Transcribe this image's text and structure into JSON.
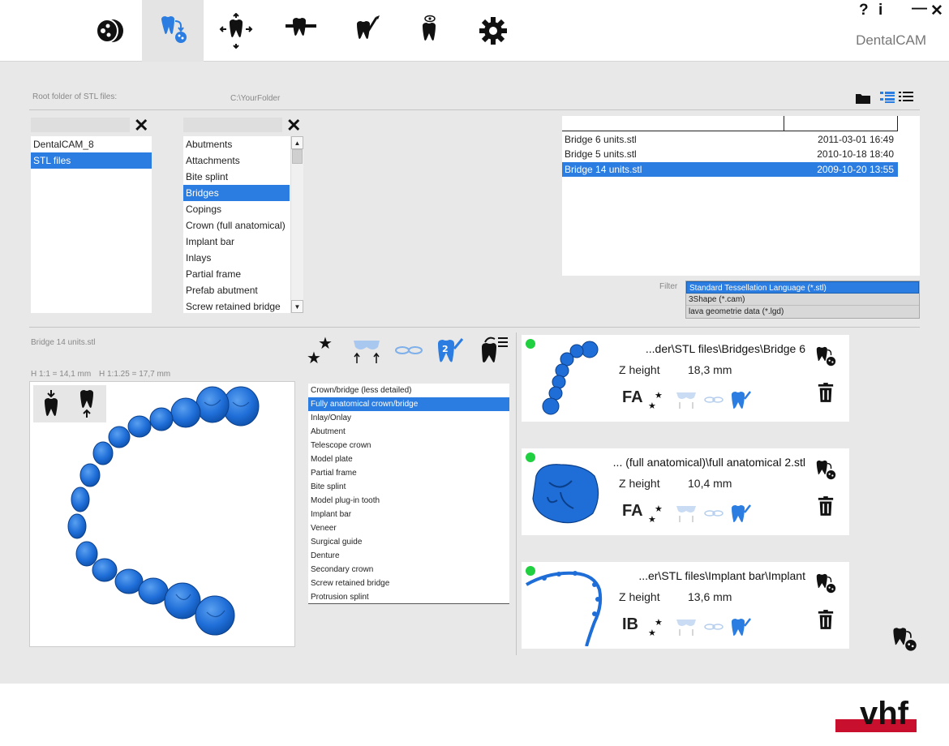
{
  "app": {
    "title": "DentalCAM",
    "help": "?",
    "info": "i",
    "minimize": "—",
    "close": "✕"
  },
  "tabs": [
    {
      "icon": "material-disc-icon",
      "active": false
    },
    {
      "icon": "tooth-import-icon",
      "active": true
    },
    {
      "icon": "tooth-position-icon",
      "active": false
    },
    {
      "icon": "tooth-holder-icon",
      "active": false
    },
    {
      "icon": "tooth-calculate-icon",
      "active": false
    },
    {
      "icon": "tooth-view-icon",
      "active": false
    },
    {
      "icon": "gear-icon",
      "active": false
    }
  ],
  "root": {
    "label": "Root folder of STL files:",
    "path": "C:\\YourFolder"
  },
  "folders": {
    "items": [
      "DentalCAM_8",
      "STL files"
    ],
    "selected": 1
  },
  "categories": {
    "items": [
      "Abutments",
      "Attachments",
      "Bite splint",
      "Bridges",
      "Copings",
      "Crown (full anatomical)",
      "Implant bar",
      "Inlays",
      "Partial frame",
      "Prefab abutment",
      "Screw retained bridge"
    ],
    "selected": 3
  },
  "files": [
    {
      "name": "Bridge 6 units.stl",
      "date": "2011-03-01  16:49"
    },
    {
      "name": "Bridge 5 units.stl",
      "date": "2010-10-18  18:40"
    },
    {
      "name": "Bridge 14 units.stl",
      "date": "2009-10-20  13:55",
      "selected": true
    }
  ],
  "filter": {
    "label": "Filter",
    "options": [
      "Standard Tessellation Language (*.stl)",
      "3Shape (*.cam)",
      "lava geometrie data (*.lgd)"
    ],
    "selected": 0
  },
  "preview": {
    "filename": "Bridge 14 units.stl",
    "scale1": "H 1:1 = 14,1 mm",
    "scale2": "H 1:1.25 = 17,7 mm"
  },
  "types": {
    "items": [
      "Crown/bridge (less detailed)",
      "Fully anatomical crown/bridge",
      "Inlay/Onlay",
      "Abutment",
      "Telescope crown",
      "Model plate",
      "Partial frame",
      "Bite splint",
      "Model plug-in tooth",
      "Implant bar",
      "Veneer",
      "Surgical guide",
      "Denture",
      "Secondary crown",
      "Screw retained bridge",
      "Protrusion splint"
    ],
    "selected": 1
  },
  "jobs": [
    {
      "path": "...der\\STL files\\Bridges\\Bridge 6",
      "z_label": "Z height",
      "z_value": "18,3 mm",
      "badge": "FA",
      "thumb": "arch"
    },
    {
      "path": "... (full anatomical)\\full anatomical 2.stl",
      "z_label": "Z height",
      "z_value": "10,4 mm",
      "badge": "FA",
      "thumb": "crown"
    },
    {
      "path": "...er\\STL files\\Implant bar\\Implant",
      "z_label": "Z height",
      "z_value": "13,6 mm",
      "badge": "IB",
      "thumb": "bar"
    }
  ],
  "colors": {
    "accent": "#2b7de1",
    "model": "#1f6ed8",
    "status_ok": "#20d040",
    "brand_red": "#c8102e"
  },
  "logo_text": "vhf"
}
